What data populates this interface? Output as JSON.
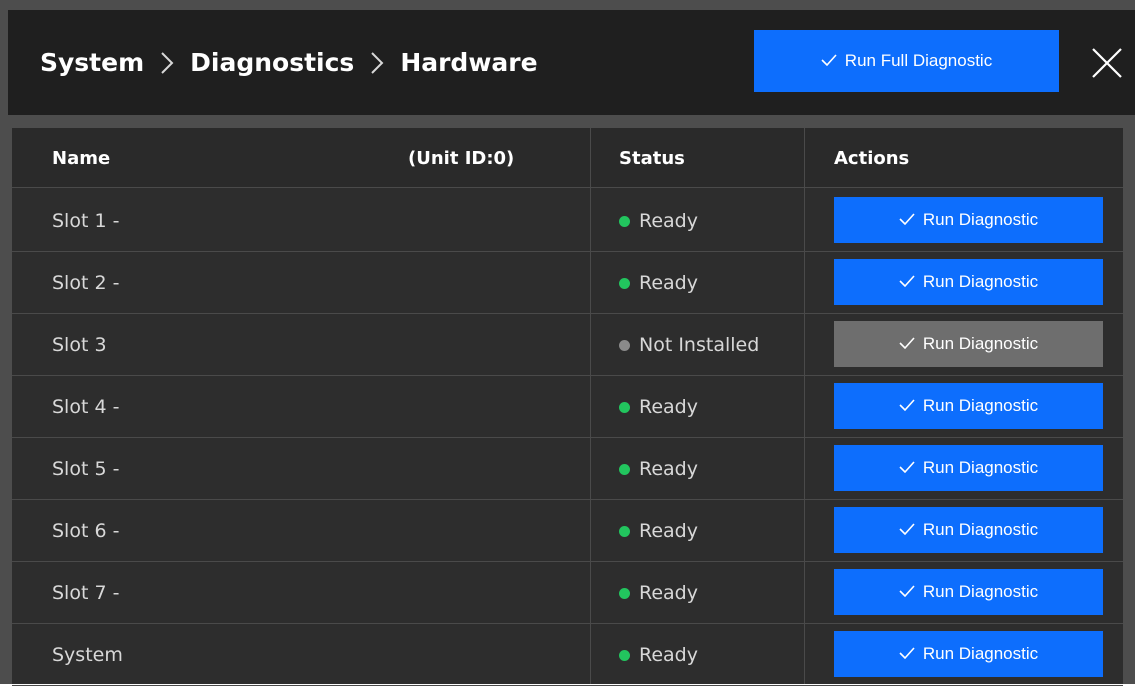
{
  "header": {
    "breadcrumb": [
      "System",
      "Diagnostics",
      "Hardware"
    ],
    "full_diagnostic_label": "Run Full Diagnostic",
    "icons": {
      "separator": "chevron-right-icon",
      "check": "check-icon",
      "close": "close-icon"
    }
  },
  "table": {
    "columns": {
      "name": "Name",
      "unit": "(Unit ID:0)",
      "status": "Status",
      "actions": "Actions"
    },
    "rows": [
      {
        "name": "Slot 1 -",
        "status": "Ready",
        "action": "Run Diagnostic",
        "enabled": true
      },
      {
        "name": "Slot 2 -",
        "status": "Ready",
        "action": "Run Diagnostic",
        "enabled": true
      },
      {
        "name": "Slot 3",
        "status": "Not Installed",
        "action": "Run Diagnostic",
        "enabled": false
      },
      {
        "name": "Slot 4 -",
        "status": "Ready",
        "action": "Run Diagnostic",
        "enabled": true
      },
      {
        "name": "Slot 5 -",
        "status": "Ready",
        "action": "Run Diagnostic",
        "enabled": true
      },
      {
        "name": "Slot 6 -",
        "status": "Ready",
        "action": "Run Diagnostic",
        "enabled": true
      },
      {
        "name": "Slot 7 -",
        "status": "Ready",
        "action": "Run Diagnostic",
        "enabled": true
      },
      {
        "name": "System",
        "status": "Ready",
        "action": "Run Diagnostic",
        "enabled": true
      }
    ]
  },
  "colors": {
    "accent": "#0d6efd",
    "disabled_button": "#6e6e6e",
    "status_ready": "#22c55e",
    "status_not_installed": "#8a8a8a",
    "header_bg": "#1f1f1f",
    "table_bg": "#2d2d2d"
  }
}
